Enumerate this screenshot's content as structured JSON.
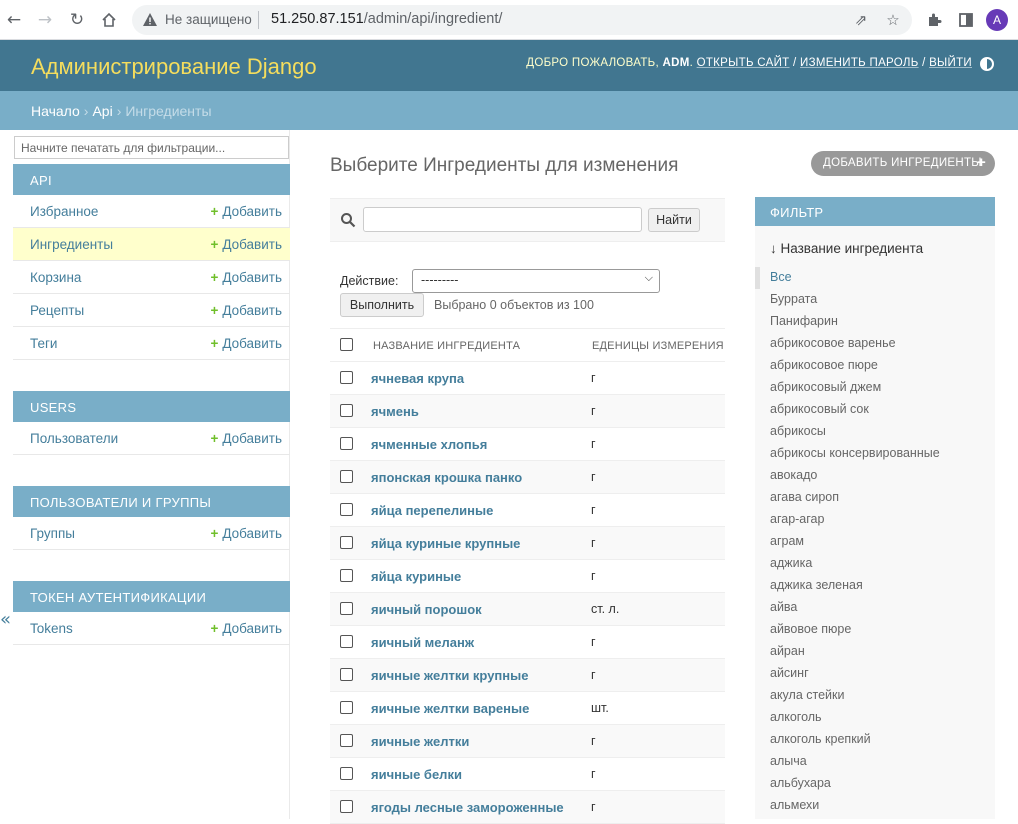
{
  "browser": {
    "insecure_label": "Не защищено",
    "url_host": "51.250.87.151",
    "url_path": "/admin/api/ingredient/",
    "avatar_letter": "A"
  },
  "header": {
    "brand": "Администрирование Django",
    "welcome": "ДОБРО ПОЖАЛОВАТЬ,",
    "username": "ADM",
    "open_site": "ОТКРЫТЬ САЙТ",
    "change_password": "ИЗМЕНИТЬ ПАРОЛЬ",
    "logout": "ВЫЙТИ",
    "accent_color": "#417690",
    "brand_color": "#f5dd5d"
  },
  "breadcrumbs": {
    "home": "Начало",
    "app": "Api",
    "current": "Ингредиенты"
  },
  "sidebar": {
    "filter_placeholder": "Начните печатать для фильтрации...",
    "add_label": "Добавить",
    "modules": [
      {
        "caption": "API",
        "items": [
          "Избранное",
          "Ингредиенты",
          "Корзина",
          "Рецепты",
          "Теги"
        ]
      },
      {
        "caption": "USERS",
        "items": [
          "Пользователи"
        ]
      },
      {
        "caption": "ПОЛЬЗОВАТЕЛИ И ГРУППЫ",
        "items": [
          "Группы"
        ]
      },
      {
        "caption": "ТОКЕН АУТЕНТИФИКАЦИИ",
        "items": [
          "Tokens"
        ]
      }
    ],
    "active_item": "Ингредиенты"
  },
  "main": {
    "title": "Выберите Ингредиенты для изменения",
    "add_button": "ДОБАВИТЬ ИНГРЕДИЕНТЫ",
    "search_button": "Найти",
    "search_value": "",
    "action_label": "Действие:",
    "action_selected": "---------",
    "go_button": "Выполнить",
    "selected_count": "Выбрано 0 объектов из 100",
    "columns": [
      "НАЗВАНИЕ ИНГРЕДИЕНТА",
      "ЕДЕНИЦЫ ИЗМЕРЕНИЯ"
    ],
    "rows": [
      {
        "name": "ячневая крупа",
        "unit": "г"
      },
      {
        "name": "ячмень",
        "unit": "г"
      },
      {
        "name": "ячменные хлопья",
        "unit": "г"
      },
      {
        "name": "японская крошка панко",
        "unit": "г"
      },
      {
        "name": "яйца перепелиные",
        "unit": "г"
      },
      {
        "name": "яйца куриные крупные",
        "unit": "г"
      },
      {
        "name": "яйца куриные",
        "unit": "г"
      },
      {
        "name": "яичный порошок",
        "unit": "ст. л."
      },
      {
        "name": "яичный меланж",
        "unit": "г"
      },
      {
        "name": "яичные желтки крупные",
        "unit": "г"
      },
      {
        "name": "яичные желтки вареные",
        "unit": "шт."
      },
      {
        "name": "яичные желтки",
        "unit": "г"
      },
      {
        "name": "яичные белки",
        "unit": "г"
      },
      {
        "name": "ягоды лесные замороженные",
        "unit": "г"
      }
    ]
  },
  "filter": {
    "caption": "ФИЛЬТР",
    "heading": "↓ Название ингредиента",
    "items": [
      "Все",
      "Буррата",
      "Панифарин",
      "абрикосовое варенье",
      "абрикосовое пюре",
      "абрикосовый джем",
      "абрикосовый сок",
      "абрикосы",
      "абрикосы консервированные",
      "авокадо",
      "агава сироп",
      "агар-агар",
      "аграм",
      "аджика",
      "аджика зеленая",
      "айва",
      "айвовое пюре",
      "айран",
      "айсинг",
      "акула стейки",
      "алкоголь",
      "алкоголь крепкий",
      "алыча",
      "альбухара",
      "альмехи"
    ]
  }
}
